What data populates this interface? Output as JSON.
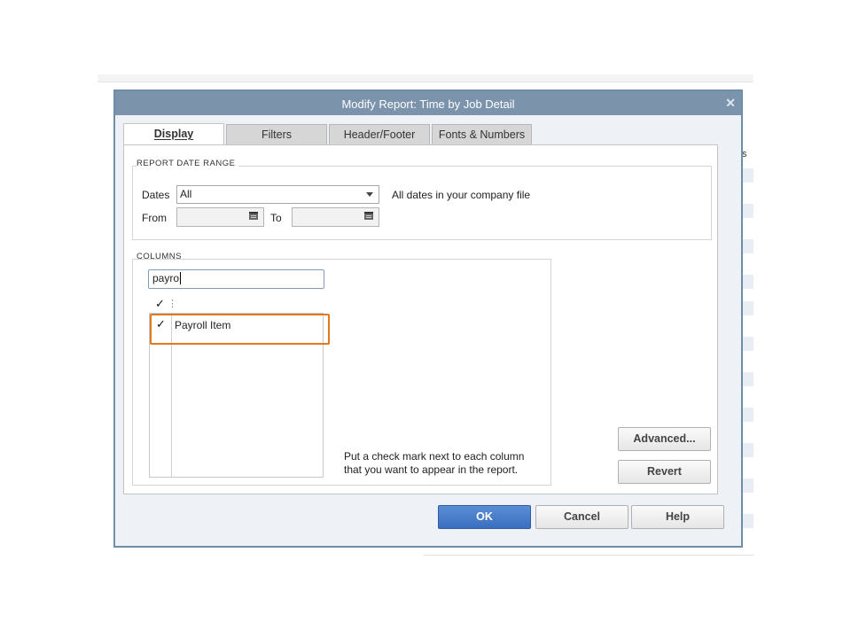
{
  "dialog": {
    "title": "Modify Report: Time by Job Detail",
    "close_icon": "close-icon"
  },
  "tabs": [
    {
      "label": "Display",
      "active": true
    },
    {
      "label": "Filters",
      "active": false
    },
    {
      "label": "Header/Footer",
      "active": false
    },
    {
      "label": "Fonts & Numbers",
      "active": false
    }
  ],
  "date_range": {
    "section_label": "REPORT DATE RANGE",
    "dates_label": "Dates",
    "dates_value": "All",
    "dates_description": "All dates in your company file",
    "from_label": "From",
    "from_value": "",
    "to_label": "To",
    "to_value": ""
  },
  "columns": {
    "section_label": "COLUMNS",
    "search_value": "payro",
    "header_check": "✓",
    "header_dots": "⋮",
    "items": [
      {
        "checked": true,
        "check": "✓",
        "label": "Payroll Item"
      }
    ],
    "help_line1": "Put a check mark next to each column",
    "help_line2": "that you want to appear in the report."
  },
  "buttons": {
    "advanced": "Advanced...",
    "revert": "Revert",
    "ok": "OK",
    "cancel": "Cancel",
    "help": "Help"
  },
  "background": {
    "col_s": "s"
  },
  "colors": {
    "titlebar": "#7b93ab",
    "primary_button": "#3a6fc0",
    "highlight": "#e07a1f"
  }
}
